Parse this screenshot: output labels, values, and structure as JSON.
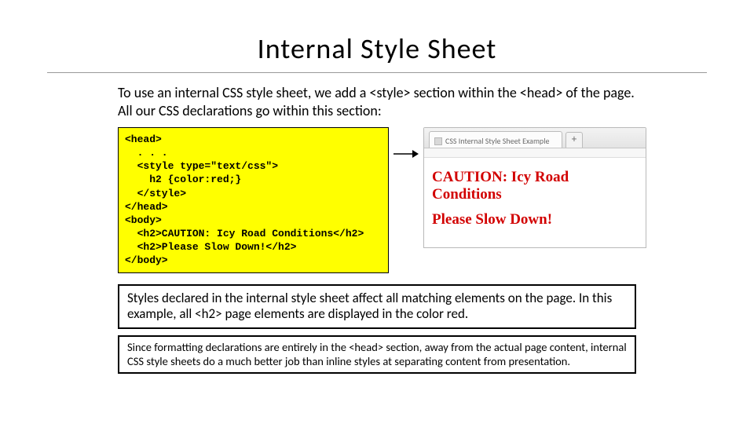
{
  "title": "Internal Style Sheet",
  "intro": "To use an internal CSS style sheet, we add a <style> section within the <head> of the page.  All our CSS declarations go within this section:",
  "code": {
    "l1": "<head>",
    "l2": "  . . .",
    "l3": "  <style type=\"text/css\">",
    "l4": "    h2 {color:red;}",
    "l5": "  </style>",
    "l6": "</head>",
    "l7": "<body>",
    "l8": "  <h2>CAUTION: Icy Road Conditions</h2>",
    "l9": "  <h2>Please Slow Down!</h2>",
    "l10": "</body>"
  },
  "browser": {
    "tab_title": "CSS Internal Style Sheet Example",
    "plus": "+",
    "h2a": "CAUTION: Icy Road Conditions",
    "h2b": "Please Slow Down!"
  },
  "note1": "Styles declared in the internal style sheet affect all matching elements on the page.  In this example, all <h2> page elements are displayed in the color red.",
  "note2": "Since formatting declarations are entirely in the <head> section, away from the actual page content, internal CSS style sheets do a much better job than inline styles at separating content from presentation."
}
